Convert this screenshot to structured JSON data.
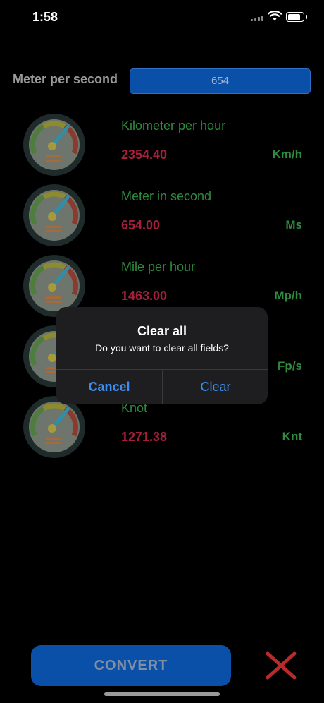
{
  "status": {
    "time": "1:58"
  },
  "input": {
    "label": "Meter per second",
    "value": "654"
  },
  "units": [
    {
      "name": "Kilometer per hour",
      "value": "2354.40",
      "abbr": "Km/h"
    },
    {
      "name": "Meter in second",
      "value": "654.00",
      "abbr": "Ms"
    },
    {
      "name": "Mile per hour",
      "value": "1463.00",
      "abbr": "Mp/h"
    },
    {
      "name": "",
      "value": "",
      "abbr": "Fp/s"
    },
    {
      "name": "Knot",
      "value": "1271.38",
      "abbr": "Knt"
    }
  ],
  "dialog": {
    "title": "Clear all",
    "message": "Do you want to clear all fields?",
    "cancel": "Cancel",
    "confirm": "Clear"
  },
  "actions": {
    "convert": "CONVERT",
    "close_icon": "close-x-icon"
  },
  "colors": {
    "background": "#000000",
    "button_blue": "#0a4fa8",
    "unit_green": "#2e8b3e",
    "value_red": "#a41f3b",
    "dialog_bg": "#1e1e20",
    "dialog_action": "#3d8ef0",
    "close_red": "#b82b2b"
  }
}
